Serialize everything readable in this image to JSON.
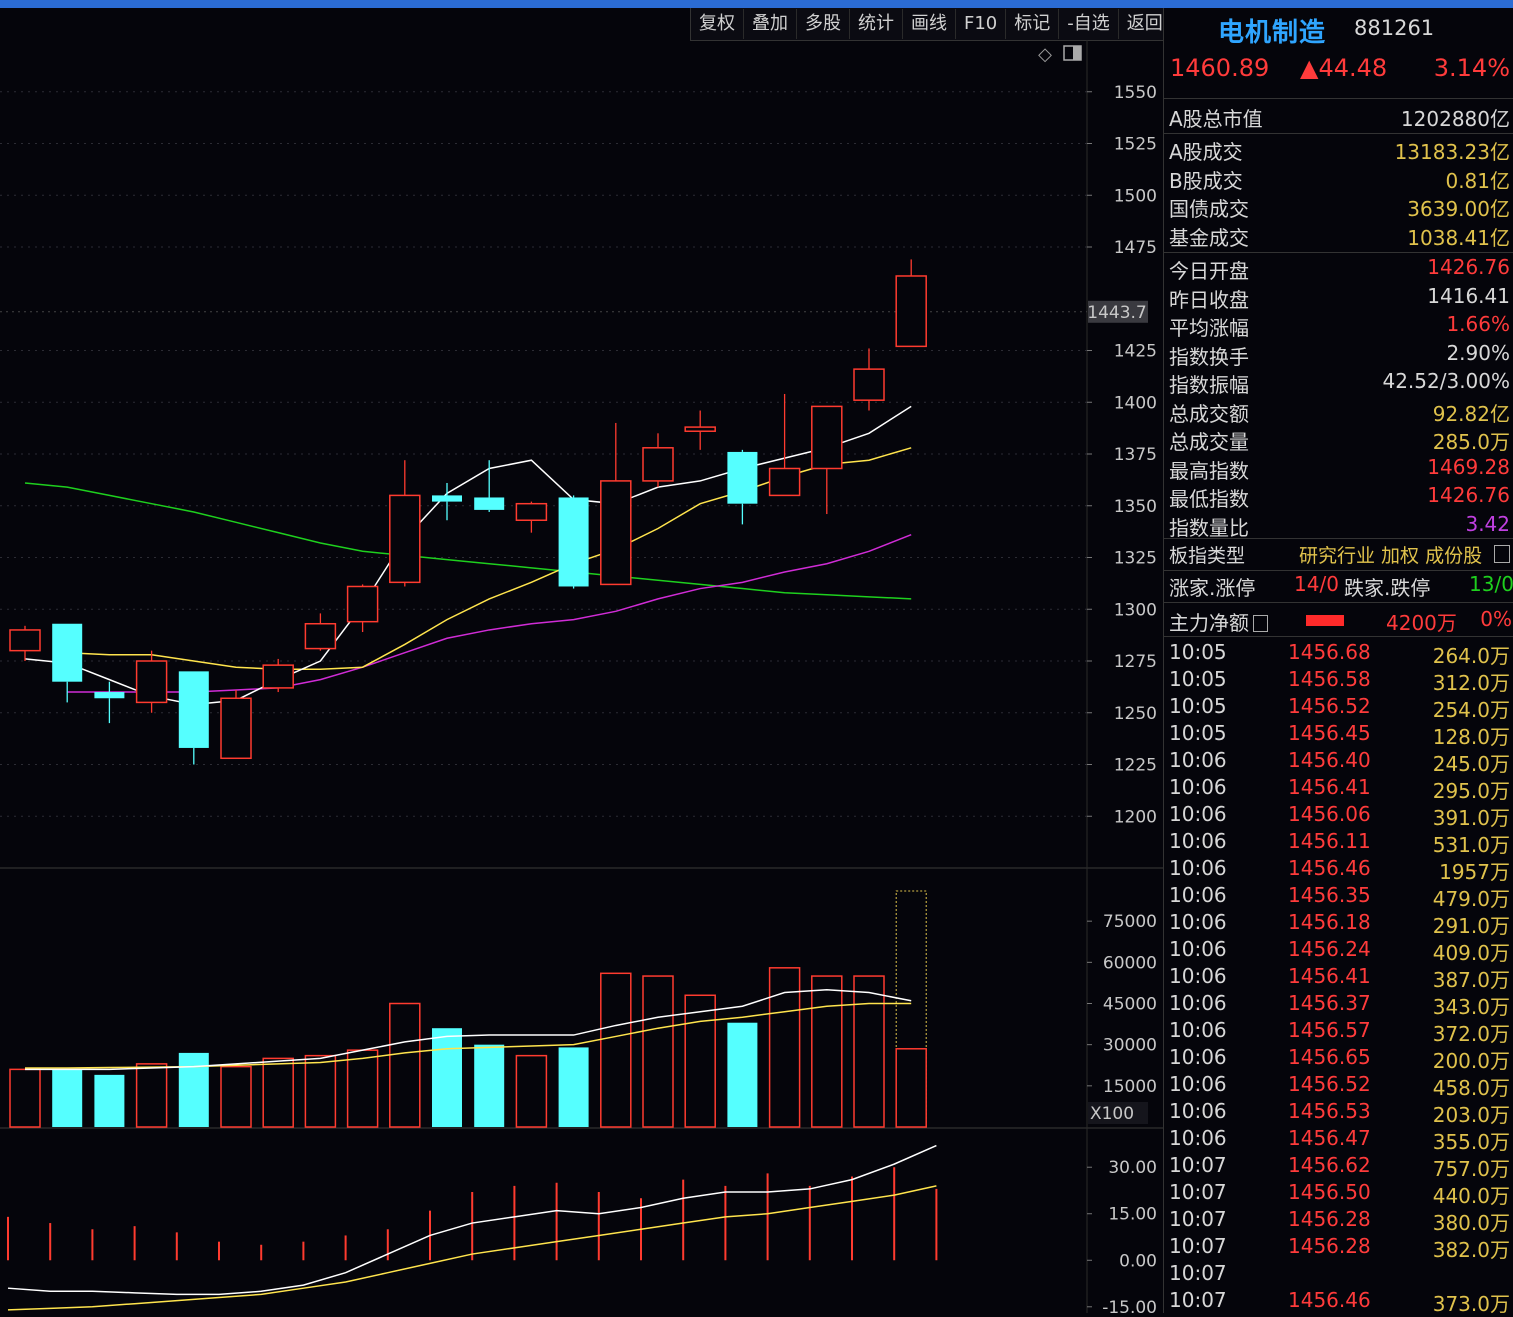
{
  "toolbar": {
    "items": [
      "复权",
      "叠加",
      "多股",
      "统计",
      "画线",
      "F10",
      "标记",
      "-自选",
      "返回"
    ]
  },
  "colors": {
    "up": "#ff3b2f",
    "down": "#55ffff",
    "ma5": "#ffffff",
    "ma10": "#ffe44d",
    "ma20": "#d02cd6",
    "ma60": "#1ed01e",
    "accent": "#2fa5ff"
  },
  "chart_data": [
    {
      "type": "candlestick",
      "ylim": [
        1175,
        1575
      ],
      "y_ticks": [
        1550,
        1525,
        1500,
        1475,
        1425,
        1400,
        1375,
        1350,
        1325,
        1300,
        1275,
        1250,
        1225,
        1200
      ],
      "crosshair_label": "1443.7",
      "candles": [
        {
          "o": 1280,
          "c": 1290,
          "h": 1292,
          "l": 1275
        },
        {
          "o": 1293,
          "c": 1265,
          "h": 1293,
          "l": 1255
        },
        {
          "o": 1260,
          "c": 1257,
          "h": 1265,
          "l": 1245
        },
        {
          "o": 1255,
          "c": 1275,
          "h": 1280,
          "l": 1250
        },
        {
          "o": 1270,
          "c": 1233,
          "h": 1270,
          "l": 1225
        },
        {
          "o": 1228,
          "c": 1257,
          "h": 1261,
          "l": 1228
        },
        {
          "o": 1262,
          "c": 1273,
          "h": 1276,
          "l": 1260
        },
        {
          "o": 1281,
          "c": 1293,
          "h": 1298,
          "l": 1280
        },
        {
          "o": 1294,
          "c": 1311,
          "h": 1312,
          "l": 1289
        },
        {
          "o": 1313,
          "c": 1355,
          "h": 1372,
          "l": 1311
        },
        {
          "o": 1355,
          "c": 1352,
          "h": 1361,
          "l": 1343
        },
        {
          "o": 1354,
          "c": 1348,
          "h": 1372,
          "l": 1347
        },
        {
          "o": 1343,
          "c": 1351,
          "h": 1352,
          "l": 1337
        },
        {
          "o": 1354,
          "c": 1311,
          "h": 1355,
          "l": 1310
        },
        {
          "o": 1312,
          "c": 1362,
          "h": 1390,
          "l": 1312
        },
        {
          "o": 1362,
          "c": 1378,
          "h": 1385,
          "l": 1359
        },
        {
          "o": 1386,
          "c": 1388,
          "h": 1396,
          "l": 1377
        },
        {
          "o": 1376,
          "c": 1351,
          "h": 1377,
          "l": 1341
        },
        {
          "o": 1355,
          "c": 1368,
          "h": 1404,
          "l": 1355
        },
        {
          "o": 1368,
          "c": 1398,
          "h": 1398,
          "l": 1346
        },
        {
          "o": 1401,
          "c": 1416,
          "h": 1426,
          "l": 1396
        },
        {
          "o": 1427,
          "c": 1461,
          "h": 1469,
          "l": 1427
        }
      ],
      "ma5": [
        1276,
        1274,
        1266,
        1258,
        1254,
        1256,
        1266,
        1275,
        1302,
        1334,
        1356,
        1368,
        1372,
        1353,
        1351,
        1359,
        1362,
        1368,
        1373,
        1378,
        1385,
        1398
      ],
      "ma10": [
        1279,
        1278,
        1278,
        1275,
        1272,
        1271,
        1271,
        1272,
        1283,
        1295,
        1305,
        1313,
        1322,
        1329,
        1339,
        1351,
        1357,
        1364,
        1370,
        1372,
        1378
      ],
      "ma20": [
        1260,
        1260,
        1260,
        1260,
        1261,
        1262,
        1266,
        1272,
        1279,
        1286,
        1290,
        1293,
        1295,
        1299,
        1305,
        1310,
        1313,
        1318,
        1322,
        1328,
        1336
      ],
      "ma60": [
        1361,
        1359,
        1355,
        1351,
        1347,
        1342,
        1337,
        1332,
        1328,
        1326,
        1324,
        1322,
        1320,
        1318,
        1316,
        1314,
        1312,
        1310,
        1308,
        1307,
        1306,
        1305
      ]
    },
    {
      "type": "bar",
      "name": "volume",
      "unit_label": "X100",
      "ylim": [
        0,
        90000
      ],
      "y_ticks": [
        75000,
        60000,
        45000,
        30000,
        15000
      ],
      "values": [
        21000,
        21000,
        19000,
        23000,
        27000,
        22000,
        25000,
        26000,
        28000,
        45000,
        36000,
        30000,
        26000,
        29000,
        56000,
        55000,
        48000,
        38000,
        58000,
        55000,
        55000,
        28500
      ],
      "projected_last": 86000,
      "ma5": [
        21000,
        21000,
        21000,
        21500,
        22000,
        23000,
        24000,
        25000,
        28000,
        31000,
        33000,
        33500,
        33500,
        33500,
        37000,
        40000,
        42000,
        44000,
        49000,
        50000,
        49000,
        46000
      ],
      "ma10": [
        21500,
        21500,
        21700,
        21800,
        22000,
        22500,
        23000,
        23500,
        25000,
        27000,
        28500,
        29000,
        29500,
        30000,
        33000,
        36000,
        38500,
        40000,
        42000,
        44000,
        45000,
        45000
      ]
    },
    {
      "type": "line",
      "name": "macd",
      "ylim": [
        -17,
        42
      ],
      "y_ticks": [
        "30.00",
        "15.00",
        "0.00",
        "-15.00"
      ],
      "y_tick_values": [
        30,
        15,
        0,
        -15
      ],
      "hist": [
        14,
        12,
        10,
        11,
        9,
        6,
        5,
        6,
        8,
        10,
        16,
        22,
        24,
        25,
        22,
        20,
        26,
        24,
        28,
        24,
        27,
        30,
        23
      ],
      "dif": [
        -9,
        -10,
        -10,
        -10.5,
        -11,
        -11,
        -10,
        -8,
        -4,
        2,
        8,
        12,
        14,
        16,
        15,
        17,
        20,
        22,
        22,
        23,
        26,
        31,
        37
      ],
      "dea": [
        -16,
        -15.5,
        -15,
        -14,
        -13,
        -12,
        -11,
        -9,
        -7,
        -4,
        -1,
        2,
        4,
        6,
        8,
        10,
        12,
        14,
        15,
        17,
        19,
        21,
        24
      ]
    }
  ],
  "panel": {
    "title": "电机制造",
    "code": "881261",
    "price": "1460.89",
    "change": "▲44.48",
    "pct": "3.14%",
    "market_cap": {
      "label": "A股总市值",
      "value": "1202880亿"
    },
    "turnover": [
      {
        "label": "A股成交",
        "value": "13183.23亿"
      },
      {
        "label": "B股成交",
        "value": "0.81亿"
      },
      {
        "label": "国债成交",
        "value": "3639.00亿"
      },
      {
        "label": "基金成交",
        "value": "1038.41亿"
      }
    ],
    "stats": [
      {
        "label": "今日开盘",
        "value": "1426.76",
        "color": "#ff3b3b"
      },
      {
        "label": "昨日收盘",
        "value": "1416.41",
        "color": "#d8d8d8"
      },
      {
        "label": "平均涨幅",
        "value": "1.66%",
        "color": "#ff3b3b"
      },
      {
        "label": "指数换手",
        "value": "2.90%",
        "color": "#d8d8d8"
      },
      {
        "label": "指数振幅",
        "value": "42.52/3.00%",
        "color": "#d8d8d8"
      },
      {
        "label": "总成交额",
        "value": "92.82亿",
        "color": "#e0c24c"
      },
      {
        "label": "总成交量",
        "value": "285.0万",
        "color": "#e0c24c"
      },
      {
        "label": "最高指数",
        "value": "1469.28",
        "color": "#ff3b3b"
      },
      {
        "label": "最低指数",
        "value": "1426.76",
        "color": "#ff3b3b"
      },
      {
        "label": "指数量比",
        "value": "3.42",
        "color": "#c040e0"
      }
    ],
    "type_label": "板指类型",
    "type_value": "研究行业 加权 成份股",
    "limit": {
      "up_label": "涨家.涨停",
      "up_value": "14/0",
      "down_label": "跌家.跌停",
      "down_value": "13/0"
    },
    "flow": {
      "label": "主力净额",
      "value": "4200万",
      "pct": "0%"
    },
    "ticks": [
      {
        "t": "10:05",
        "p": "1456.68",
        "v": "264.0万"
      },
      {
        "t": "10:05",
        "p": "1456.58",
        "v": "312.0万"
      },
      {
        "t": "10:05",
        "p": "1456.52",
        "v": "254.0万"
      },
      {
        "t": "10:05",
        "p": "1456.45",
        "v": "128.0万"
      },
      {
        "t": "10:06",
        "p": "1456.40",
        "v": "245.0万"
      },
      {
        "t": "10:06",
        "p": "1456.41",
        "v": "295.0万"
      },
      {
        "t": "10:06",
        "p": "1456.06",
        "v": "391.0万"
      },
      {
        "t": "10:06",
        "p": "1456.11",
        "v": "531.0万"
      },
      {
        "t": "10:06",
        "p": "1456.46",
        "v": "1957万"
      },
      {
        "t": "10:06",
        "p": "1456.35",
        "v": "479.0万"
      },
      {
        "t": "10:06",
        "p": "1456.18",
        "v": "291.0万"
      },
      {
        "t": "10:06",
        "p": "1456.24",
        "v": "409.0万"
      },
      {
        "t": "10:06",
        "p": "1456.41",
        "v": "387.0万"
      },
      {
        "t": "10:06",
        "p": "1456.37",
        "v": "343.0万"
      },
      {
        "t": "10:06",
        "p": "1456.57",
        "v": "372.0万"
      },
      {
        "t": "10:06",
        "p": "1456.65",
        "v": "200.0万"
      },
      {
        "t": "10:06",
        "p": "1456.52",
        "v": "458.0万"
      },
      {
        "t": "10:06",
        "p": "1456.53",
        "v": "203.0万"
      },
      {
        "t": "10:06",
        "p": "1456.47",
        "v": "355.0万"
      },
      {
        "t": "10:07",
        "p": "1456.62",
        "v": "757.0万"
      },
      {
        "t": "10:07",
        "p": "1456.50",
        "v": "440.0万"
      },
      {
        "t": "10:07",
        "p": "1456.28",
        "v": "380.0万"
      },
      {
        "t": "10:07",
        "p": "1456.28",
        "v": "382.0万"
      },
      {
        "t": "10:07",
        "p": "",
        "v": ""
      },
      {
        "t": "10:07",
        "p": "1456.46",
        "v": "373.0万"
      }
    ]
  }
}
